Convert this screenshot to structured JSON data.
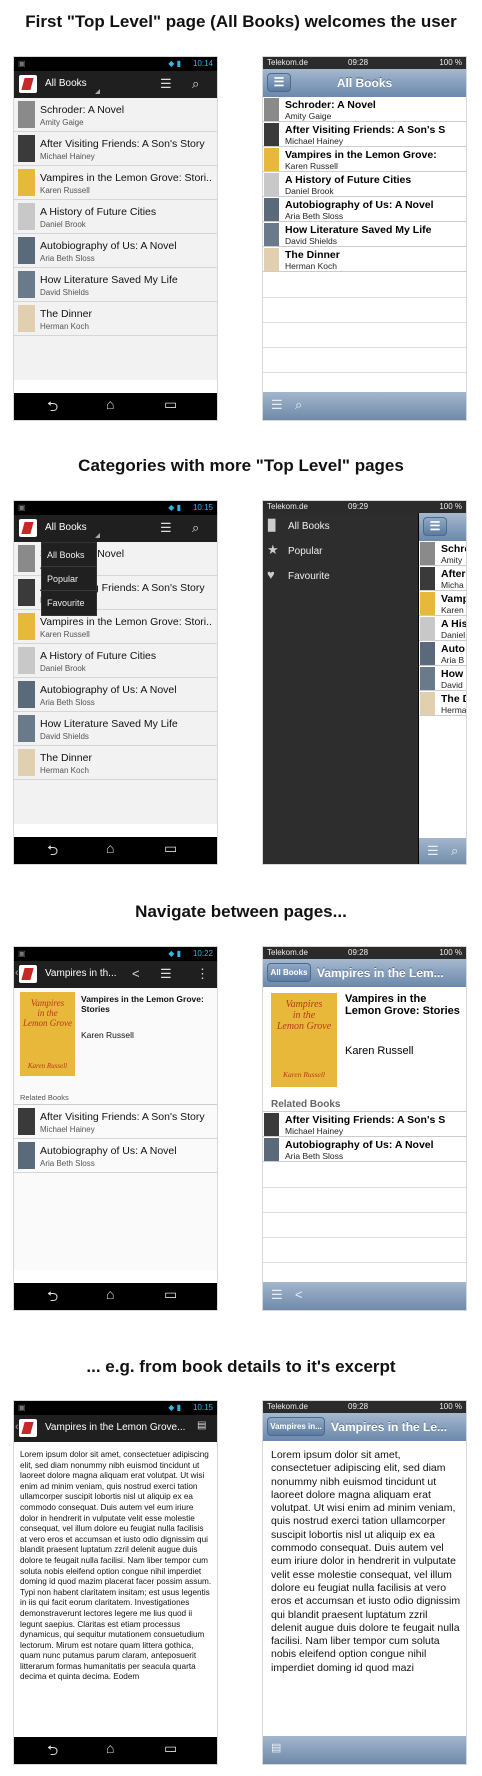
{
  "sections": [
    "First \"Top Level\" page (All Books) welcomes the user",
    "Categories with more \"Top Level\" pages",
    "Navigate between pages...",
    "... e.g. from book details to it's excerpt"
  ],
  "android": {
    "times": [
      "10:14",
      "10:15",
      "10:22",
      "10:15"
    ],
    "all_books": "All Books"
  },
  "ios": {
    "carrier": "Telekom.de",
    "time": "09:28",
    "time2": "09:29",
    "battery": "100 %",
    "all_books": "All Books",
    "back_all": "All Books",
    "back_vamp": "Vampires in..."
  },
  "books": [
    {
      "title": "Schroder: A Novel",
      "author": "Amity Gaige",
      "color": "#8a8a8a"
    },
    {
      "title": "After Visiting Friends: A Son's Story",
      "author": "Michael Hainey",
      "color": "#3a3a3a"
    },
    {
      "title": "Vampires in the Lemon Grove: Stori...",
      "author": "Karen Russell",
      "color": "#e8b83a"
    },
    {
      "title": "A History of Future Cities",
      "author": "Daniel Brook",
      "color": "#c8c8c8"
    },
    {
      "title": "Autobiography of Us: A Novel",
      "author": "Aria Beth Sloss",
      "color": "#5a6a7a"
    },
    {
      "title": "How Literature Saved My Life",
      "author": "David Shields",
      "color": "#6a7a8a"
    },
    {
      "title": "The Dinner",
      "author": "Herman Koch",
      "color": "#e0d0b0"
    }
  ],
  "ios_books": [
    {
      "title": "Schroder: A Novel",
      "author": "Amity Gaige"
    },
    {
      "title": "After Visiting Friends: A Son's S",
      "author": "Michael Hainey"
    },
    {
      "title": "Vampires in the Lemon Grove:",
      "author": "Karen Russell"
    },
    {
      "title": "A History of Future Cities",
      "author": "Daniel Brook"
    },
    {
      "title": "Autobiography of Us: A Novel",
      "author": "Aria Beth Sloss"
    },
    {
      "title": "How Literature Saved My Life",
      "author": "David Shields"
    },
    {
      "title": "The Dinner",
      "author": "Herman Koch"
    }
  ],
  "ios_cut": [
    {
      "title": "Schro",
      "author": "Amity"
    },
    {
      "title": "After",
      "author": "Micha"
    },
    {
      "title": "Vamp",
      "author": "Karen"
    },
    {
      "title": "A His",
      "author": "Daniel"
    },
    {
      "title": "Auto",
      "author": "Aria B"
    },
    {
      "title": "How",
      "author": "David"
    },
    {
      "title": "The D",
      "author": "Herma"
    }
  ],
  "android_menu": [
    "All Books",
    "Popular",
    "Favourite"
  ],
  "ios_menu": [
    "All Books",
    "Popular",
    "Favourite"
  ],
  "detail": {
    "android_title": "Vampires in th...",
    "ios_title": "Vampires in the Lem...",
    "book_title": "Vampires in the Lemon Grove: Stories",
    "author": "Karen Russell",
    "related_label_android": "Related Books",
    "related_label_ios": "Related Books",
    "related": [
      {
        "title": "After Visiting Friends: A Son's Story",
        "author": "Michael Hainey"
      },
      {
        "title": "Autobiography of Us: A Novel",
        "author": "Aria Beth Sloss"
      }
    ],
    "ios_related": [
      {
        "title": "After Visiting Friends: A Son's S",
        "author": "Michael Hainey"
      },
      {
        "title": "Autobiography of Us: A Novel",
        "author": "Aria Beth Sloss"
      }
    ],
    "cover_text": [
      "Vampires",
      "in the",
      "Lemon Grove",
      "Karen Russell"
    ]
  },
  "excerpt": {
    "android_title": "Vampires in the Lemon Grove...",
    "ios_title": "Vampires in the Le...",
    "android_text": "Lorem ipsum dolor sit amet, consectetuer adipiscing elit, sed diam nonummy nibh euismod tincidunt ut laoreet dolore magna aliquam erat volutpat. Ut wisi enim ad minim veniam, quis nostrud exerci tation ullamcorper suscipit lobortis nisl ut aliquip ex ea commodo consequat. Duis autem vel eum iriure dolor in hendrerit in vulputate velit esse molestie consequat, vel illum dolore eu feugiat nulla facilisis at vero eros et accumsan et iusto odio dignissim qui blandit praesent luptatum zzril delenit augue duis dolore te feugait nulla facilisi. Nam liber tempor cum soluta nobis eleifend option congue nihil imperdiet doming id quod mazim placerat facer possim assum. Typi non habent claritatem insitam; est usus legentis in iis qui facit eorum claritatem. Investigationes demonstraverunt lectores legere me lius quod ii legunt saepius. Claritas est etiam processus dynamicus, qui sequitur mutationem consuetudium lectorum. Mirum est notare quam littera gothica, quam nunc putamus parum claram, anteposuerit litterarum formas humanitatis per seacula quarta decima et quinta decima. Eodem",
    "ios_text": "Lorem ipsum dolor sit amet, consectetuer adipiscing elit, sed diam nonummy nibh euismod tincidunt ut laoreet dolore magna aliquam erat volutpat. Ut wisi enim ad minim veniam, quis nostrud exerci tation ullamcorper suscipit lobortis nisl ut aliquip ex ea commodo consequat. Duis autem vel eum iriure dolor in hendrerit in vulputate velit esse molestie consequat, vel illum dolore eu feugiat nulla facilisis at vero eros et accumsan et iusto odio dignissim qui blandit praesent luptatum zzril delenit augue duis dolore te feugait nulla facilisi. Nam liber tempor cum soluta nobis eleifend option congue nihil imperdiet doming id quod mazi"
  }
}
